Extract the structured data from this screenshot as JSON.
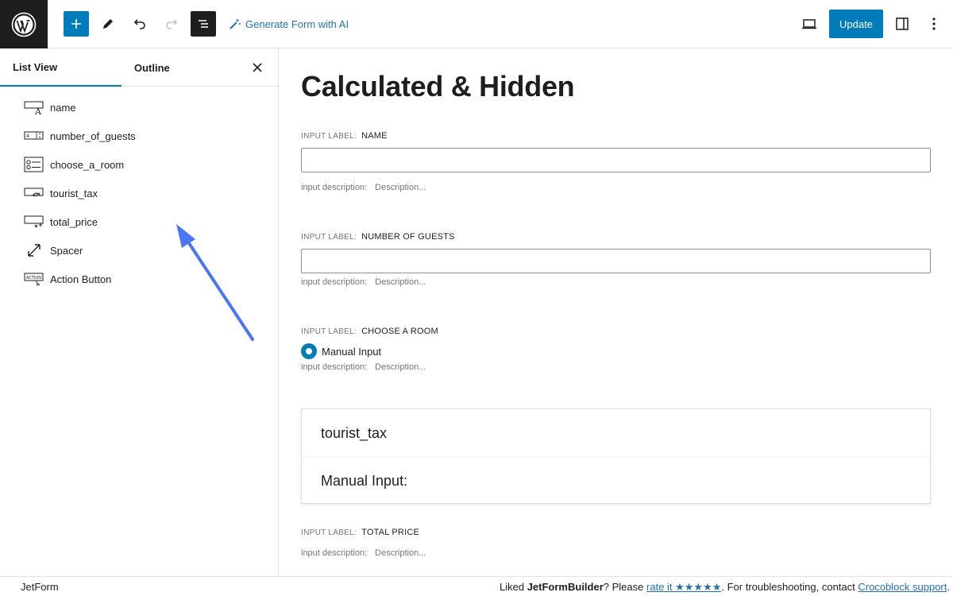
{
  "toolbar": {
    "ai_label": "Generate Form with AI",
    "update_label": "Update"
  },
  "sidebar": {
    "tabs": [
      {
        "label": "List View"
      },
      {
        "label": "Outline"
      }
    ],
    "items": [
      {
        "label": "name",
        "icon": "text-field-icon"
      },
      {
        "label": "number_of_guests",
        "icon": "number-field-icon"
      },
      {
        "label": "choose_a_room",
        "icon": "radio-field-icon"
      },
      {
        "label": "tourist_tax",
        "icon": "hidden-field-icon"
      },
      {
        "label": "total_price",
        "icon": "calculated-field-icon"
      },
      {
        "label": "Spacer",
        "icon": "resize-icon"
      },
      {
        "label": "Action Button",
        "icon": "action-button-icon"
      }
    ]
  },
  "canvas": {
    "title": "Calculated & Hidden",
    "label_prefix": "INPUT LABEL:",
    "desc_prefix": "input description:",
    "desc_placeholder": "Description...",
    "fields": [
      {
        "label": "NAME"
      },
      {
        "label": "NUMBER OF GUESTS"
      },
      {
        "label": "CHOOSE A ROOM",
        "option": "Manual Input"
      },
      {
        "label": "TOTAL PRICE"
      }
    ],
    "calc_box": {
      "name": "tourist_tax",
      "formula": "Manual Input:"
    }
  },
  "footer": {
    "breadcrumb": "JetForm",
    "credit_1": "Liked ",
    "credit_brand": "JetFormBuilder",
    "credit_2": "? Please ",
    "credit_link": "rate it ★★★★★",
    "credit_3": ". For troubleshooting, contact ",
    "credit_support": "Crocoblock support",
    "credit_4": "."
  },
  "colors": {
    "accent": "#007cba",
    "annotation_arrow": "#4a76f5"
  }
}
